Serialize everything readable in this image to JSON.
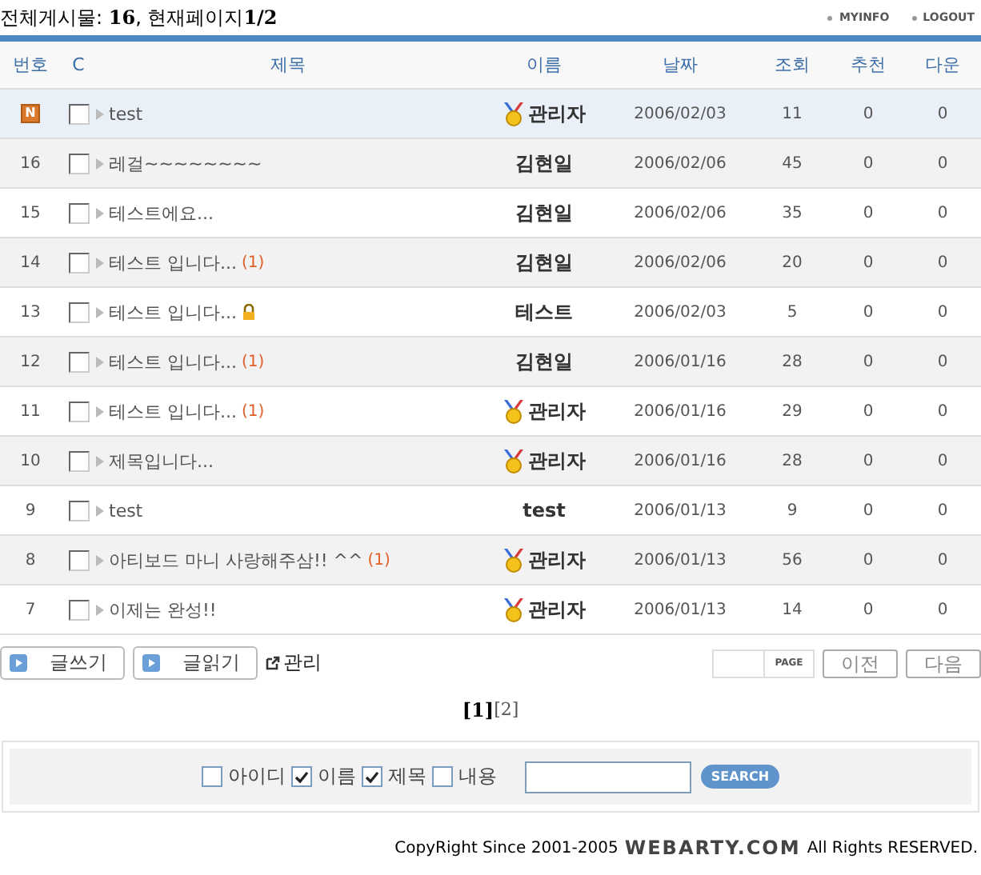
{
  "summary": "전체게시물: **16**, 현재페이지**1/2**",
  "top_links": [
    "MYINFO",
    "LOGOUT"
  ],
  "columns": [
    "번호",
    "C",
    "제목",
    "이름",
    "날짜",
    "조회",
    "추천",
    "다운"
  ],
  "rows": [
    {
      "kind": "notice",
      "number": "N",
      "checked": false,
      "title": "test",
      "admin": true,
      "author": "관리자",
      "date": "2006/02/03",
      "views": "11",
      "recommend": "0",
      "download": "0"
    },
    {
      "kind": "post",
      "number": "16",
      "checked": false,
      "title": "레걸~~~~~~~~",
      "admin": false,
      "author": "김현일",
      "date": "2006/02/06",
      "views": "45",
      "recommend": "0",
      "download": "0"
    },
    {
      "kind": "post",
      "number": "15",
      "checked": false,
      "title": "테스트에요...",
      "admin": false,
      "author": "김현일",
      "date": "2006/02/06",
      "views": "35",
      "recommend": "0",
      "download": "0"
    },
    {
      "kind": "post",
      "number": "14",
      "checked": false,
      "title": "테스트 입니다...",
      "comments": "(1)",
      "admin": false,
      "author": "김현일",
      "date": "2006/02/06",
      "views": "20",
      "recommend": "0",
      "download": "0"
    },
    {
      "kind": "post",
      "number": "13",
      "checked": false,
      "title": "테스트 입니다...",
      "locked": true,
      "admin": false,
      "author": "테스트",
      "date": "2006/02/03",
      "views": "5",
      "recommend": "0",
      "download": "0"
    },
    {
      "kind": "post",
      "number": "12",
      "checked": false,
      "title": "테스트 입니다...",
      "comments": "(1)",
      "admin": false,
      "author": "김현일",
      "date": "2006/01/16",
      "views": "28",
      "recommend": "0",
      "download": "0"
    },
    {
      "kind": "post",
      "number": "11",
      "checked": false,
      "title": "테스트 입니다...",
      "comments": "(1)",
      "admin": true,
      "author": "관리자",
      "date": "2006/01/16",
      "views": "29",
      "recommend": "0",
      "download": "0"
    },
    {
      "kind": "post",
      "number": "10",
      "checked": false,
      "title": "제목입니다...",
      "admin": true,
      "author": "관리자",
      "date": "2006/01/16",
      "views": "28",
      "recommend": "0",
      "download": "0"
    },
    {
      "kind": "post",
      "number": "9",
      "checked": false,
      "title": "test",
      "admin": false,
      "author": "test",
      "date": "2006/01/13",
      "views": "9",
      "recommend": "0",
      "download": "0"
    },
    {
      "kind": "post",
      "number": "8",
      "checked": false,
      "title": "아티보드 마니 사랑해주삼!! ^^",
      "comments": "(1)",
      "admin": true,
      "author": "관리자",
      "date": "2006/01/13",
      "views": "56",
      "recommend": "0",
      "download": "0"
    },
    {
      "kind": "post",
      "number": "7",
      "checked": false,
      "title": "이제는 완성!!",
      "admin": true,
      "author": "관리자",
      "date": "2006/01/13",
      "views": "14",
      "recommend": "0",
      "download": "0"
    }
  ],
  "actions": [
    "글쓰기",
    "글읽기"
  ],
  "manage_link": "관리",
  "page_jump": {
    "label": "PAGE",
    "prev": "이전",
    "next": "다음"
  },
  "pages": [
    {
      "label": "[1]",
      "selected": true
    },
    {
      "label": "[2]",
      "selected": false
    }
  ],
  "search": {
    "options": [
      {
        "label": "아이디",
        "checked": false
      },
      {
        "label": "이름",
        "checked": true
      },
      {
        "label": "제목",
        "checked": true
      },
      {
        "label": "내용",
        "checked": false
      }
    ],
    "button": "SEARCH"
  },
  "footer": {
    "prefix": "CopyRight Since 2001-2005",
    "brand": "WEBARTY.COM",
    "suffix": "All Rights RESERVED."
  }
}
